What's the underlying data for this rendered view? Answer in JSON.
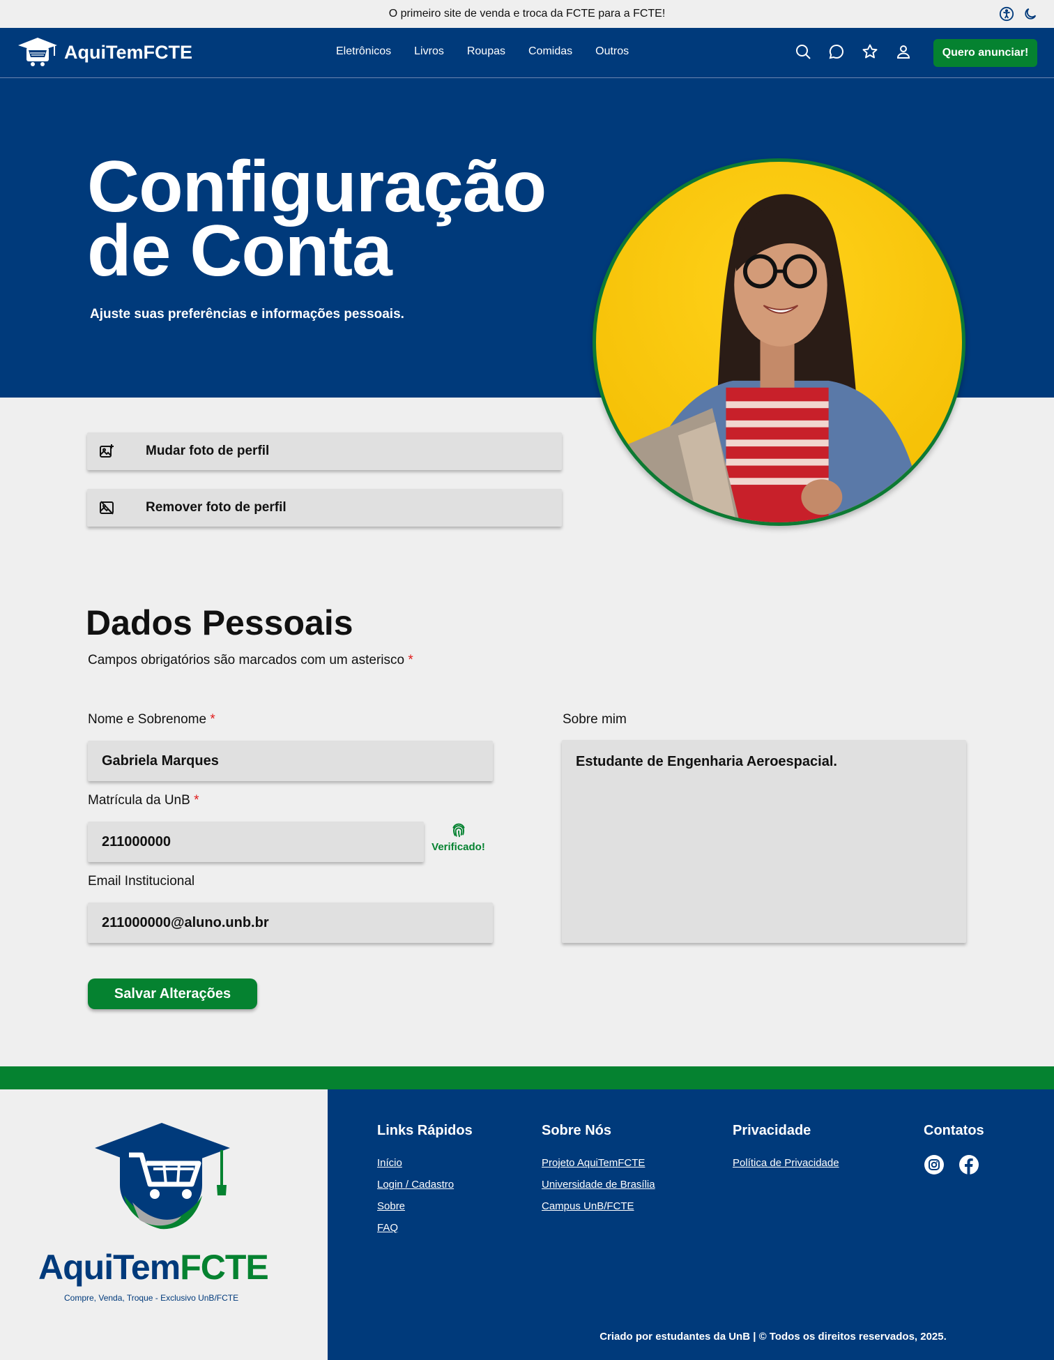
{
  "topbar": {
    "announcement": "O primeiro site de venda e troca da FCTE para a FCTE!",
    "icons": [
      "accessibility-icon",
      "dark-mode-icon"
    ]
  },
  "navbar": {
    "brand": "AquiTemFCTE",
    "links": [
      "Eletrônicos",
      "Livros",
      "Roupas",
      "Comidas",
      "Outros"
    ],
    "icons": [
      "search-icon",
      "chat-icon",
      "favorites-star-icon",
      "user-icon"
    ],
    "cta": "Quero anunciar!"
  },
  "hero": {
    "title": "Configuração de Conta",
    "subtitle": "Ajuste suas preferências e informações pessoais."
  },
  "photo_actions": {
    "change": "Mudar foto de perfil",
    "remove": "Remover foto de perfil"
  },
  "personal": {
    "title": "Dados Pessoais",
    "note": "Campos obrigatórios são marcados com um asterisco",
    "asterisk": "*",
    "name_label": "Nome e Sobrenome",
    "name_value": "Gabriela Marques",
    "matricula_label": "Matrícula da UnB",
    "matricula_value": "211000000",
    "verified": "Verificado!",
    "email_label": "Email Institucional",
    "email_value": "211000000@aluno.unb.br",
    "about_label": "Sobre mim",
    "about_value": "Estudante de Engenharia Aeroespacial.",
    "save": "Salvar Alterações"
  },
  "footer": {
    "brand_part1": "AquiTem",
    "brand_part2": "FCTE",
    "tagline": "Compre, Venda, Troque - Exclusivo UnB/FCTE",
    "quick_links": {
      "title": "Links Rápidos",
      "items": [
        "Início",
        "Login / Cadastro",
        "Sobre",
        "FAQ"
      ]
    },
    "about": {
      "title": "Sobre Nós",
      "items": [
        "Projeto AquiTemFCTE",
        "Universidade de Brasília",
        "Campus UnB/FCTE"
      ]
    },
    "privacy": {
      "title": "Privacidade",
      "items": [
        "Política de Privacidade"
      ]
    },
    "contacts": {
      "title": "Contatos",
      "icons": [
        "instagram-icon",
        "facebook-icon"
      ]
    },
    "credits": "Criado por estudantes da UnB | © Todos os direitos reservados, 2025."
  },
  "colors": {
    "primary_blue": "#003a7b",
    "accent_green": "#058230",
    "background": "#efefef",
    "field_bg": "#e0e0e0"
  }
}
